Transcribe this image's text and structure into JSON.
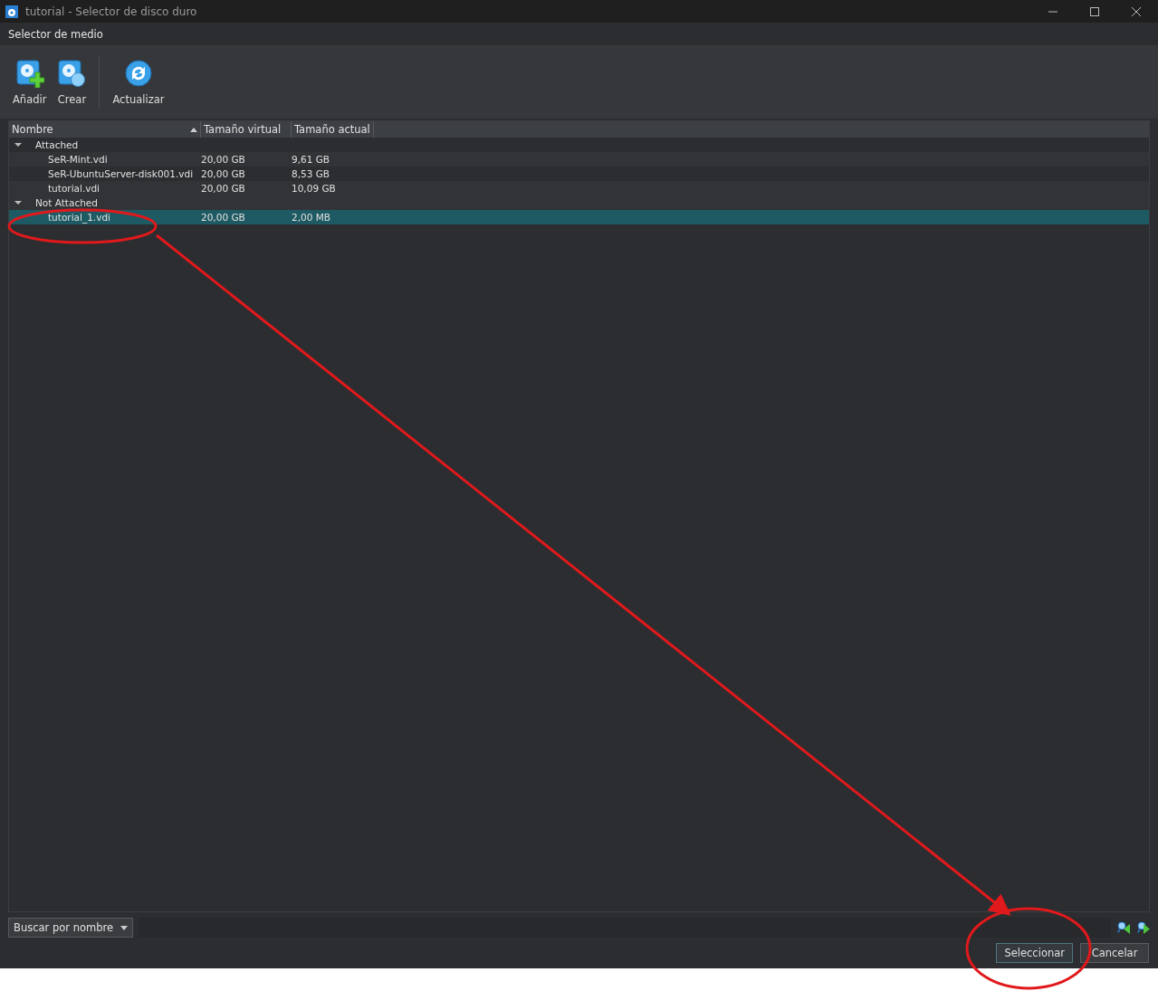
{
  "window": {
    "title": "tutorial - Selector de disco duro"
  },
  "menu": [
    "Selector de medio"
  ],
  "toolbar": [
    {
      "label": "Añadir",
      "kind": "add"
    },
    {
      "label": "Crear",
      "kind": "create"
    },
    {
      "label": "Actualizar",
      "kind": "refresh"
    }
  ],
  "table": {
    "columns": [
      "Nombre",
      "Tamaño virtual",
      "Tamaño actual"
    ],
    "groups": [
      {
        "name": "Attached",
        "expanded": true,
        "children": [
          {
            "name": "SeR-Mint.vdi",
            "virtual": "20,00 GB",
            "actual": "9,61 GB",
            "selected": false
          },
          {
            "name": "SeR-UbuntuServer-disk001.vdi",
            "virtual": "20,00 GB",
            "actual": "8,53 GB",
            "selected": false
          },
          {
            "name": "tutorial.vdi",
            "virtual": "20,00 GB",
            "actual": "10,09 GB",
            "selected": false
          }
        ]
      },
      {
        "name": "Not Attached",
        "expanded": true,
        "children": [
          {
            "name": "tutorial_1.vdi",
            "virtual": "20,00 GB",
            "actual": "2,00 MB",
            "selected": true
          }
        ]
      }
    ]
  },
  "search": {
    "mode": "Buscar por nombre"
  },
  "buttons": [
    {
      "label": "Seleccionar",
      "kind": "default"
    },
    {
      "label": "Cancelar",
      "kind": "normal"
    }
  ]
}
